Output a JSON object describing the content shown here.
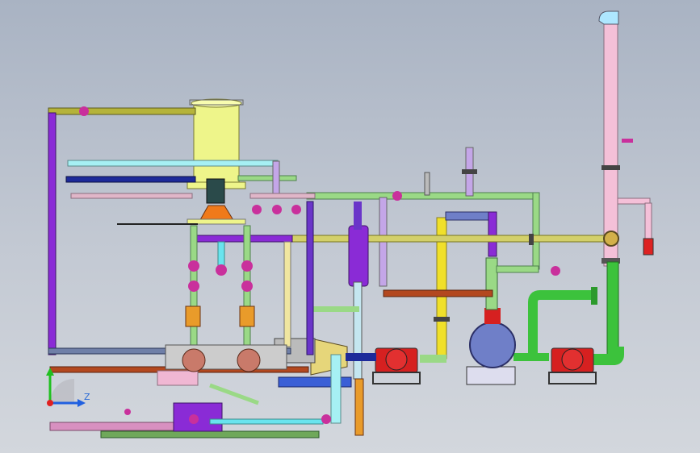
{
  "viewport": {
    "background_top": "#a9b3c3",
    "background_bottom": "#d3d7dd"
  },
  "axis_triad": {
    "z_label": "Z",
    "x_color": "#e02020",
    "y_color": "#20c020",
    "z_color": "#2060e0"
  },
  "components": [
    "vertical-tank",
    "tank-motor",
    "agitator-cone",
    "exhaust-stack",
    "centrifugal-pump-left",
    "centrifugal-pump-right",
    "horizontal-heat-exchanger",
    "vertical-filter-vessel",
    "conical-reducer",
    "pump-motor-base"
  ],
  "pipe_colors": {
    "olive": "#b5b33a",
    "light_green": "#9ad986",
    "green": "#3cc23c",
    "purple": "#8a2bd6",
    "violet": "#6a35c9",
    "light_violet": "#c4a6e8",
    "cyan": "#69e4ee",
    "navy": "#1d2a9a",
    "pink": "#f0b7d3",
    "rust": "#b3481f",
    "steel": "#6f7fa8",
    "yellow": "#f0e02a",
    "orange": "#e99b2a",
    "red": "#d62020",
    "magenta": "#c9309c",
    "tank_yellow": "#eef58a"
  }
}
